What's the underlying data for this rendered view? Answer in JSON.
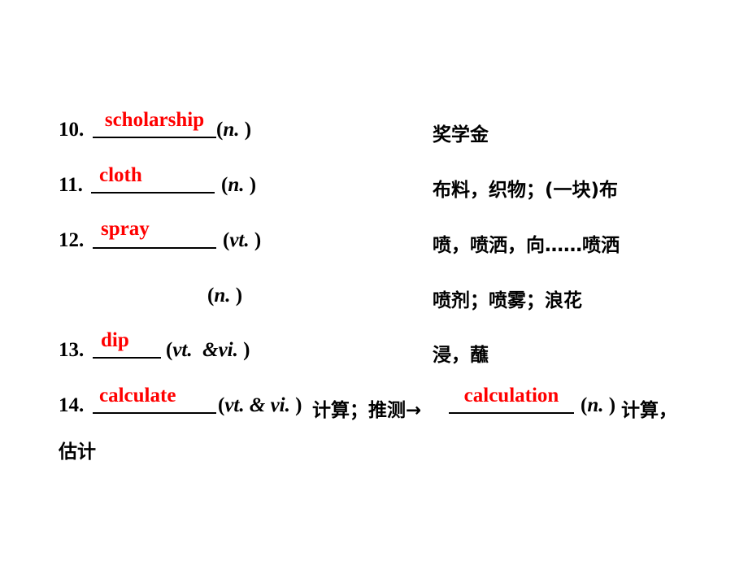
{
  "items": [
    {
      "number": "10.",
      "answer": "scholarship",
      "pos": "n.",
      "meaning": "奖学金"
    },
    {
      "number": "11.",
      "answer": "cloth",
      "pos": "n.",
      "meaning": "布料，织物；(一块)布"
    },
    {
      "number": "12.",
      "answer": "spray",
      "pos": "vt.",
      "meaning": "喷，喷洒，向……喷洒"
    },
    {
      "number": "",
      "answer": "",
      "pos": "n.",
      "meaning": "喷剂；喷雾；浪花"
    },
    {
      "number": "13.",
      "answer": "dip",
      "pos_a": "vt.",
      "pos_amp": "&",
      "pos_b": "vi.",
      "meaning": "浸，蘸"
    },
    {
      "number": "14.",
      "answer": "calculate",
      "pos_a": "vt.",
      "pos_amp": "&",
      "pos_b": "vi.",
      "meaning_a": "计算；推测→",
      "answer2": "calculation",
      "pos2": "n.",
      "meaning_b": "计算，",
      "meaning_c": "估计"
    }
  ]
}
